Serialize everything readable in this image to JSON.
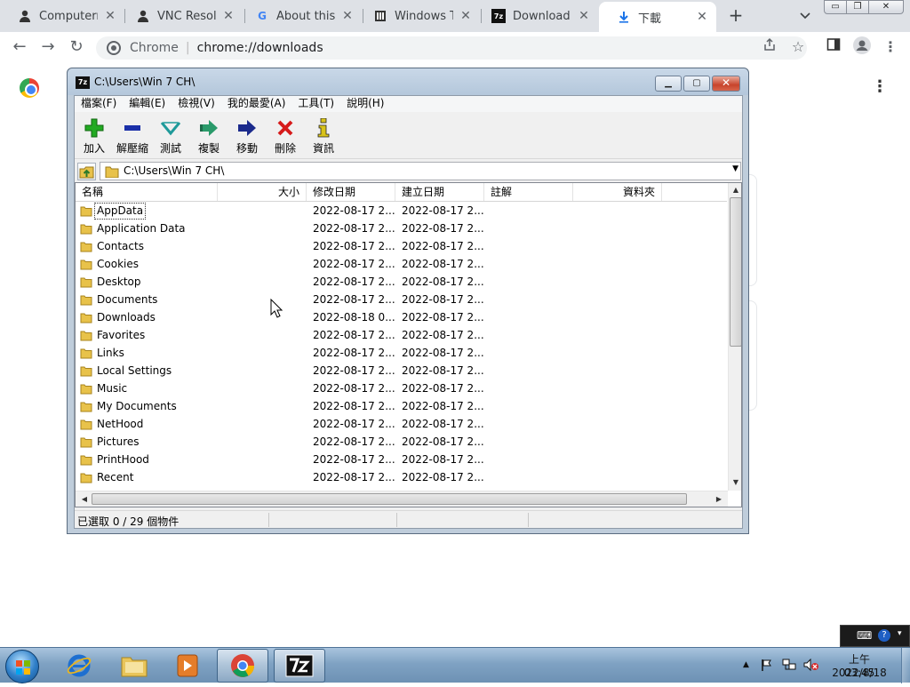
{
  "browser": {
    "tabs": [
      {
        "title": "Computerne",
        "icon": "user-icon"
      },
      {
        "title": "VNC Resolve",
        "icon": "user-icon"
      },
      {
        "title": "About this V",
        "icon": "google-icon"
      },
      {
        "title": "Windows Th",
        "icon": "book-icon"
      },
      {
        "title": "Download",
        "icon": "7zip-icon"
      },
      {
        "title": "下載",
        "icon": "download-icon"
      }
    ],
    "new_tab": "+",
    "omnibox": {
      "site": "Chrome",
      "divider": "|",
      "url": "chrome://downloads"
    }
  },
  "zip_window": {
    "title": "C:\\Users\\Win 7 CH\\",
    "menus": [
      "檔案(F)",
      "編輯(E)",
      "檢視(V)",
      "我的最愛(A)",
      "工具(T)",
      "說明(H)"
    ],
    "tools": [
      {
        "label": "加入",
        "icon": "add-icon",
        "color": "#22aa22"
      },
      {
        "label": "解壓縮",
        "icon": "extract-icon",
        "color": "#1a2fa8"
      },
      {
        "label": "測試",
        "icon": "test-icon",
        "color": "#1f9a9a"
      },
      {
        "label": "複製",
        "icon": "copy-icon",
        "color": "#2a9a6a"
      },
      {
        "label": "移動",
        "icon": "move-icon",
        "color": "#1b2a8c"
      },
      {
        "label": "刪除",
        "icon": "delete-icon",
        "color": "#d61a1a"
      },
      {
        "label": "資訊",
        "icon": "info-icon",
        "color": "#d8c21a"
      }
    ],
    "address": "C:\\Users\\Win 7 CH\\",
    "columns": {
      "name": "名稱",
      "size": "大小",
      "modified": "修改日期",
      "created": "建立日期",
      "comment": "註解",
      "folders": "資料夾"
    },
    "rows": [
      {
        "name": "AppData",
        "modified": "2022-08-17 2...",
        "created": "2022-08-17 2..."
      },
      {
        "name": "Application Data",
        "modified": "2022-08-17 2...",
        "created": "2022-08-17 2..."
      },
      {
        "name": "Contacts",
        "modified": "2022-08-17 2...",
        "created": "2022-08-17 2..."
      },
      {
        "name": "Cookies",
        "modified": "2022-08-17 2...",
        "created": "2022-08-17 2..."
      },
      {
        "name": "Desktop",
        "modified": "2022-08-17 2...",
        "created": "2022-08-17 2..."
      },
      {
        "name": "Documents",
        "modified": "2022-08-17 2...",
        "created": "2022-08-17 2..."
      },
      {
        "name": "Downloads",
        "modified": "2022-08-18 0...",
        "created": "2022-08-17 2..."
      },
      {
        "name": "Favorites",
        "modified": "2022-08-17 2...",
        "created": "2022-08-17 2..."
      },
      {
        "name": "Links",
        "modified": "2022-08-17 2...",
        "created": "2022-08-17 2..."
      },
      {
        "name": "Local Settings",
        "modified": "2022-08-17 2...",
        "created": "2022-08-17 2..."
      },
      {
        "name": "Music",
        "modified": "2022-08-17 2...",
        "created": "2022-08-17 2..."
      },
      {
        "name": "My Documents",
        "modified": "2022-08-17 2...",
        "created": "2022-08-17 2..."
      },
      {
        "name": "NetHood",
        "modified": "2022-08-17 2...",
        "created": "2022-08-17 2..."
      },
      {
        "name": "Pictures",
        "modified": "2022-08-17 2...",
        "created": "2022-08-17 2..."
      },
      {
        "name": "PrintHood",
        "modified": "2022-08-17 2...",
        "created": "2022-08-17 2..."
      },
      {
        "name": "Recent",
        "modified": "2022-08-17 2...",
        "created": "2022-08-17 2..."
      }
    ],
    "status": "已選取 0 / 29 個物件"
  },
  "taskbar": {
    "pinned": [
      "ie-icon",
      "explorer-icon",
      "media-player-icon",
      "chrome-icon",
      "7zip-icon"
    ],
    "clock": {
      "time": "上午 03:45",
      "date": "2022/8/18"
    }
  }
}
